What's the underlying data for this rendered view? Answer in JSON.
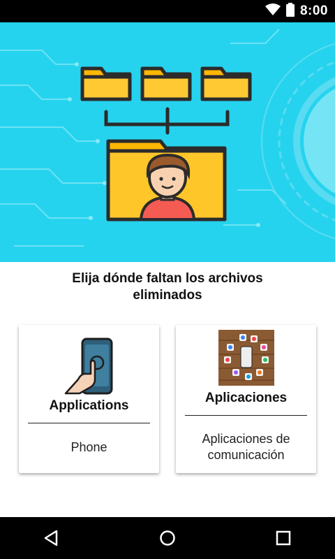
{
  "status_bar": {
    "time": "8:00",
    "icons": [
      "wifi-icon",
      "battery-icon"
    ]
  },
  "banner": {
    "background": "#26d3ee",
    "illustration": "folders-with-person"
  },
  "prompt": {
    "line1": "Elija dónde faltan los archivos",
    "line2": "eliminados"
  },
  "cards": [
    {
      "title": "Applications",
      "subtitle": "Phone",
      "subtitle_line2": ""
    },
    {
      "title": "Aplicaciones",
      "subtitle": "Aplicaciones de",
      "subtitle_line2": "comunicación"
    }
  ],
  "nav_bar": {
    "buttons": [
      "back-icon",
      "home-icon",
      "recents-icon"
    ]
  },
  "colors": {
    "accent_cyan": "#26d3ee",
    "folder_yellow": "#ffb703",
    "outline_dark": "#2b2b2b"
  }
}
